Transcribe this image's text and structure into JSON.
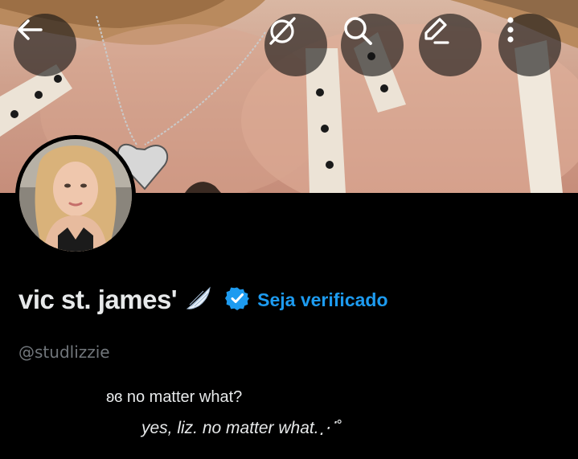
{
  "toolbar": {
    "back_icon": "arrow-left-icon",
    "grok_icon": "grok-icon",
    "search_icon": "search-icon",
    "edit_icon": "edit-pencil-icon",
    "more_icon": "more-vertical-icon"
  },
  "banner": {
    "description_icon": "banner-image"
  },
  "profile": {
    "display_name": "vic st. james'",
    "name_emoji_icon": "wing-icon",
    "verified_icon": "verified-badge-icon",
    "get_verified_label": "Seja verificado",
    "handle": "@studlizzie",
    "bio_line_1": "ʚɞ no matter what?",
    "bio_line_2": "yes, liz. no matter what.⋰˚"
  },
  "colors": {
    "background": "#000000",
    "primary_text": "#e7e9ea",
    "secondary_text": "#71767b",
    "accent": "#1d9bf0"
  }
}
